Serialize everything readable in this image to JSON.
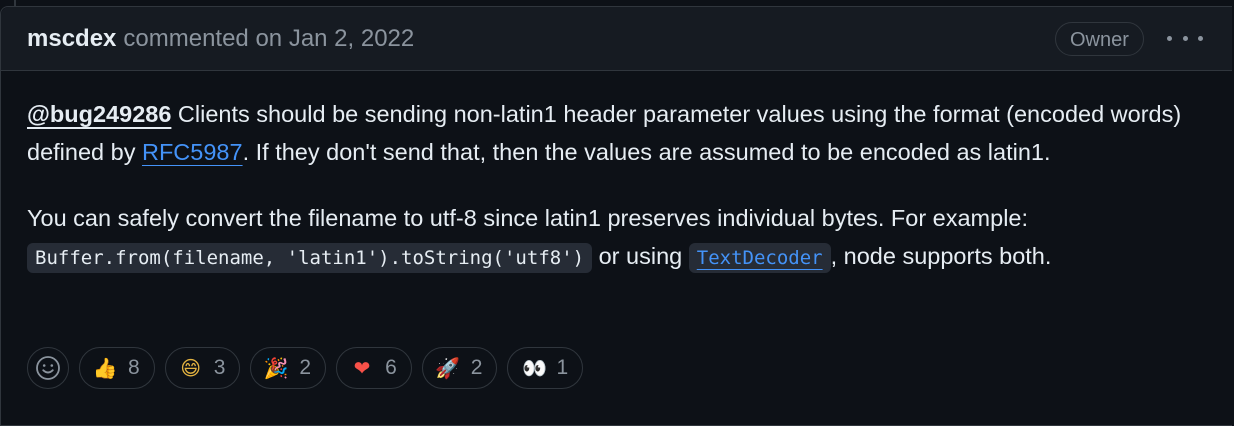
{
  "comment": {
    "author": "mscdex",
    "meta": "commented on Jan 2, 2022",
    "badge": "Owner",
    "menu_icon": "kebab-horizontal-icon"
  },
  "body": {
    "p1_mention": "@bug249286",
    "p1_text_a": " Clients should be sending non-latin1 header parameter values using the format (encoded words) defined by ",
    "p1_link": "RFC5987",
    "p1_text_b": ". If they don't send that, then the values are assumed to be encoded as latin1.",
    "p2_text_a": "You can safely convert the filename to utf-8 since latin1 preserves individual bytes. For example: ",
    "p2_code": "Buffer.from(filename, 'latin1').toString('utf8')",
    "p2_text_b": " or using ",
    "p2_code_link": "TextDecoder",
    "p2_text_c": ", node supports both."
  },
  "reactions": {
    "add_icon": "smiley-icon",
    "items": [
      {
        "name": "thumbs-up",
        "emoji": "👍",
        "count": "8"
      },
      {
        "name": "laugh",
        "emoji": "😄",
        "count": "3"
      },
      {
        "name": "hooray",
        "emoji": "🎉",
        "count": "2"
      },
      {
        "name": "heart",
        "emoji": "❤",
        "count": "6"
      },
      {
        "name": "rocket",
        "emoji": "🚀",
        "count": "2"
      },
      {
        "name": "eyes",
        "emoji": "👀",
        "count": "1"
      }
    ]
  },
  "colors": {
    "background": "#0d1117",
    "header_background": "#161b22",
    "border": "#30363d",
    "text": "#e6edf3",
    "muted": "#8b949e",
    "link": "#4493f8",
    "code_background": "#262c36"
  }
}
